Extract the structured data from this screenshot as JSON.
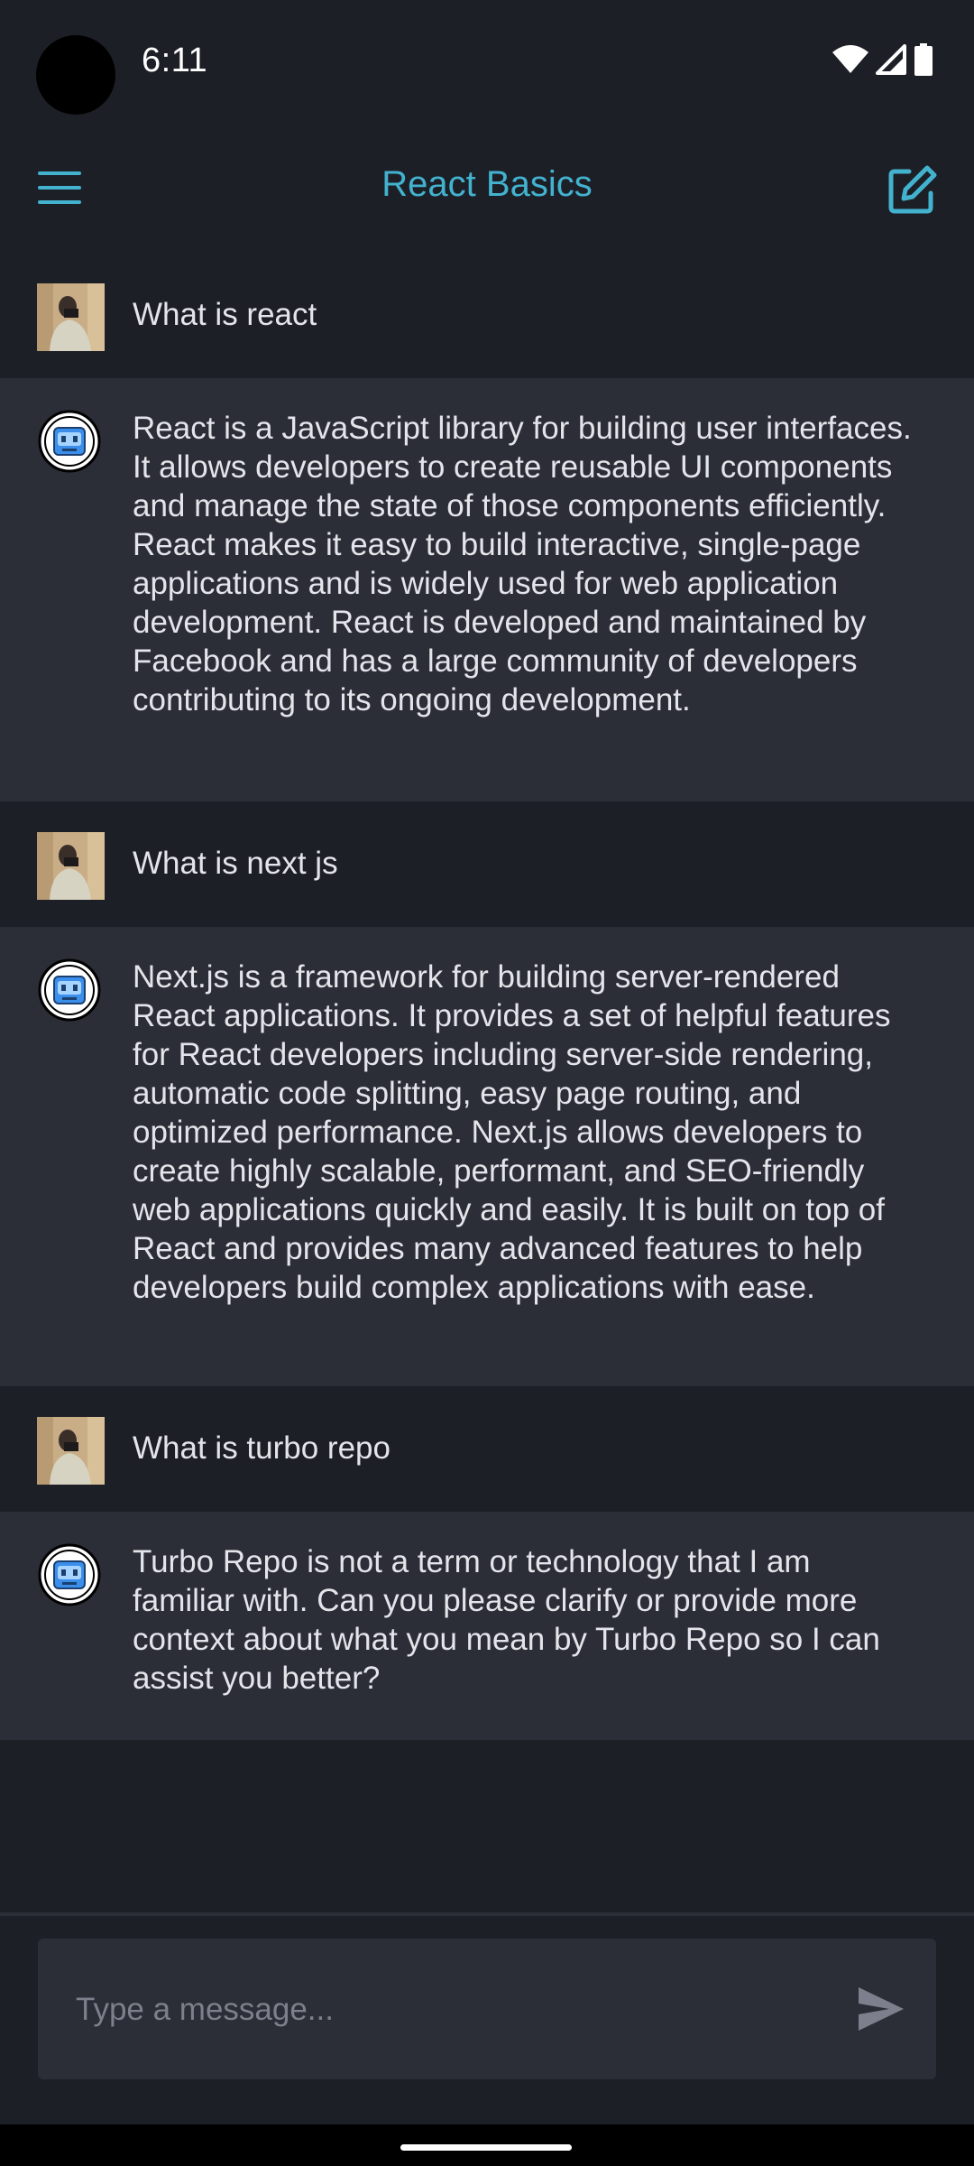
{
  "status_bar": {
    "time": "6:11",
    "icons": [
      "wifi-icon",
      "signal-icon",
      "battery-icon"
    ]
  },
  "header": {
    "title": "React Basics",
    "menu_icon": "hamburger-menu-icon",
    "action_icon": "edit-icon"
  },
  "conversation": [
    {
      "role": "user",
      "text": "What is react"
    },
    {
      "role": "assistant",
      "text": "React is a JavaScript library for building user interfaces. It allows developers to create reusable UI components and manage the state of those components efficiently. React makes it easy to build interactive, single-page applications and is widely used for web application development. React is developed and maintained by Facebook and has a large community of developers contributing to its ongoing development."
    },
    {
      "role": "user",
      "text": "What is next js"
    },
    {
      "role": "assistant",
      "text": "Next.js is a framework for building server-rendered React applications. It provides a set of helpful features for React developers including server-side rendering, automatic code splitting, easy page routing, and optimized performance. Next.js allows developers to create highly scalable, performant, and SEO-friendly web applications quickly and easily. It is built on top of React and provides many advanced features to help developers build complex applications with ease."
    },
    {
      "role": "user",
      "text": "What is turbo repo"
    },
    {
      "role": "assistant",
      "text": "Turbo Repo is not a term or technology that I am familiar with. Can you please clarify or provide more context about what you mean by Turbo Repo so I can assist you better?"
    }
  ],
  "composer": {
    "placeholder": "Type a message...",
    "value": "",
    "send_icon": "send-icon"
  },
  "colors": {
    "background": "#1d1f26",
    "assistant_bg": "#2b2d37",
    "accent": "#42b2cf",
    "text": "#e4e5ea",
    "placeholder": "#7d808c"
  }
}
